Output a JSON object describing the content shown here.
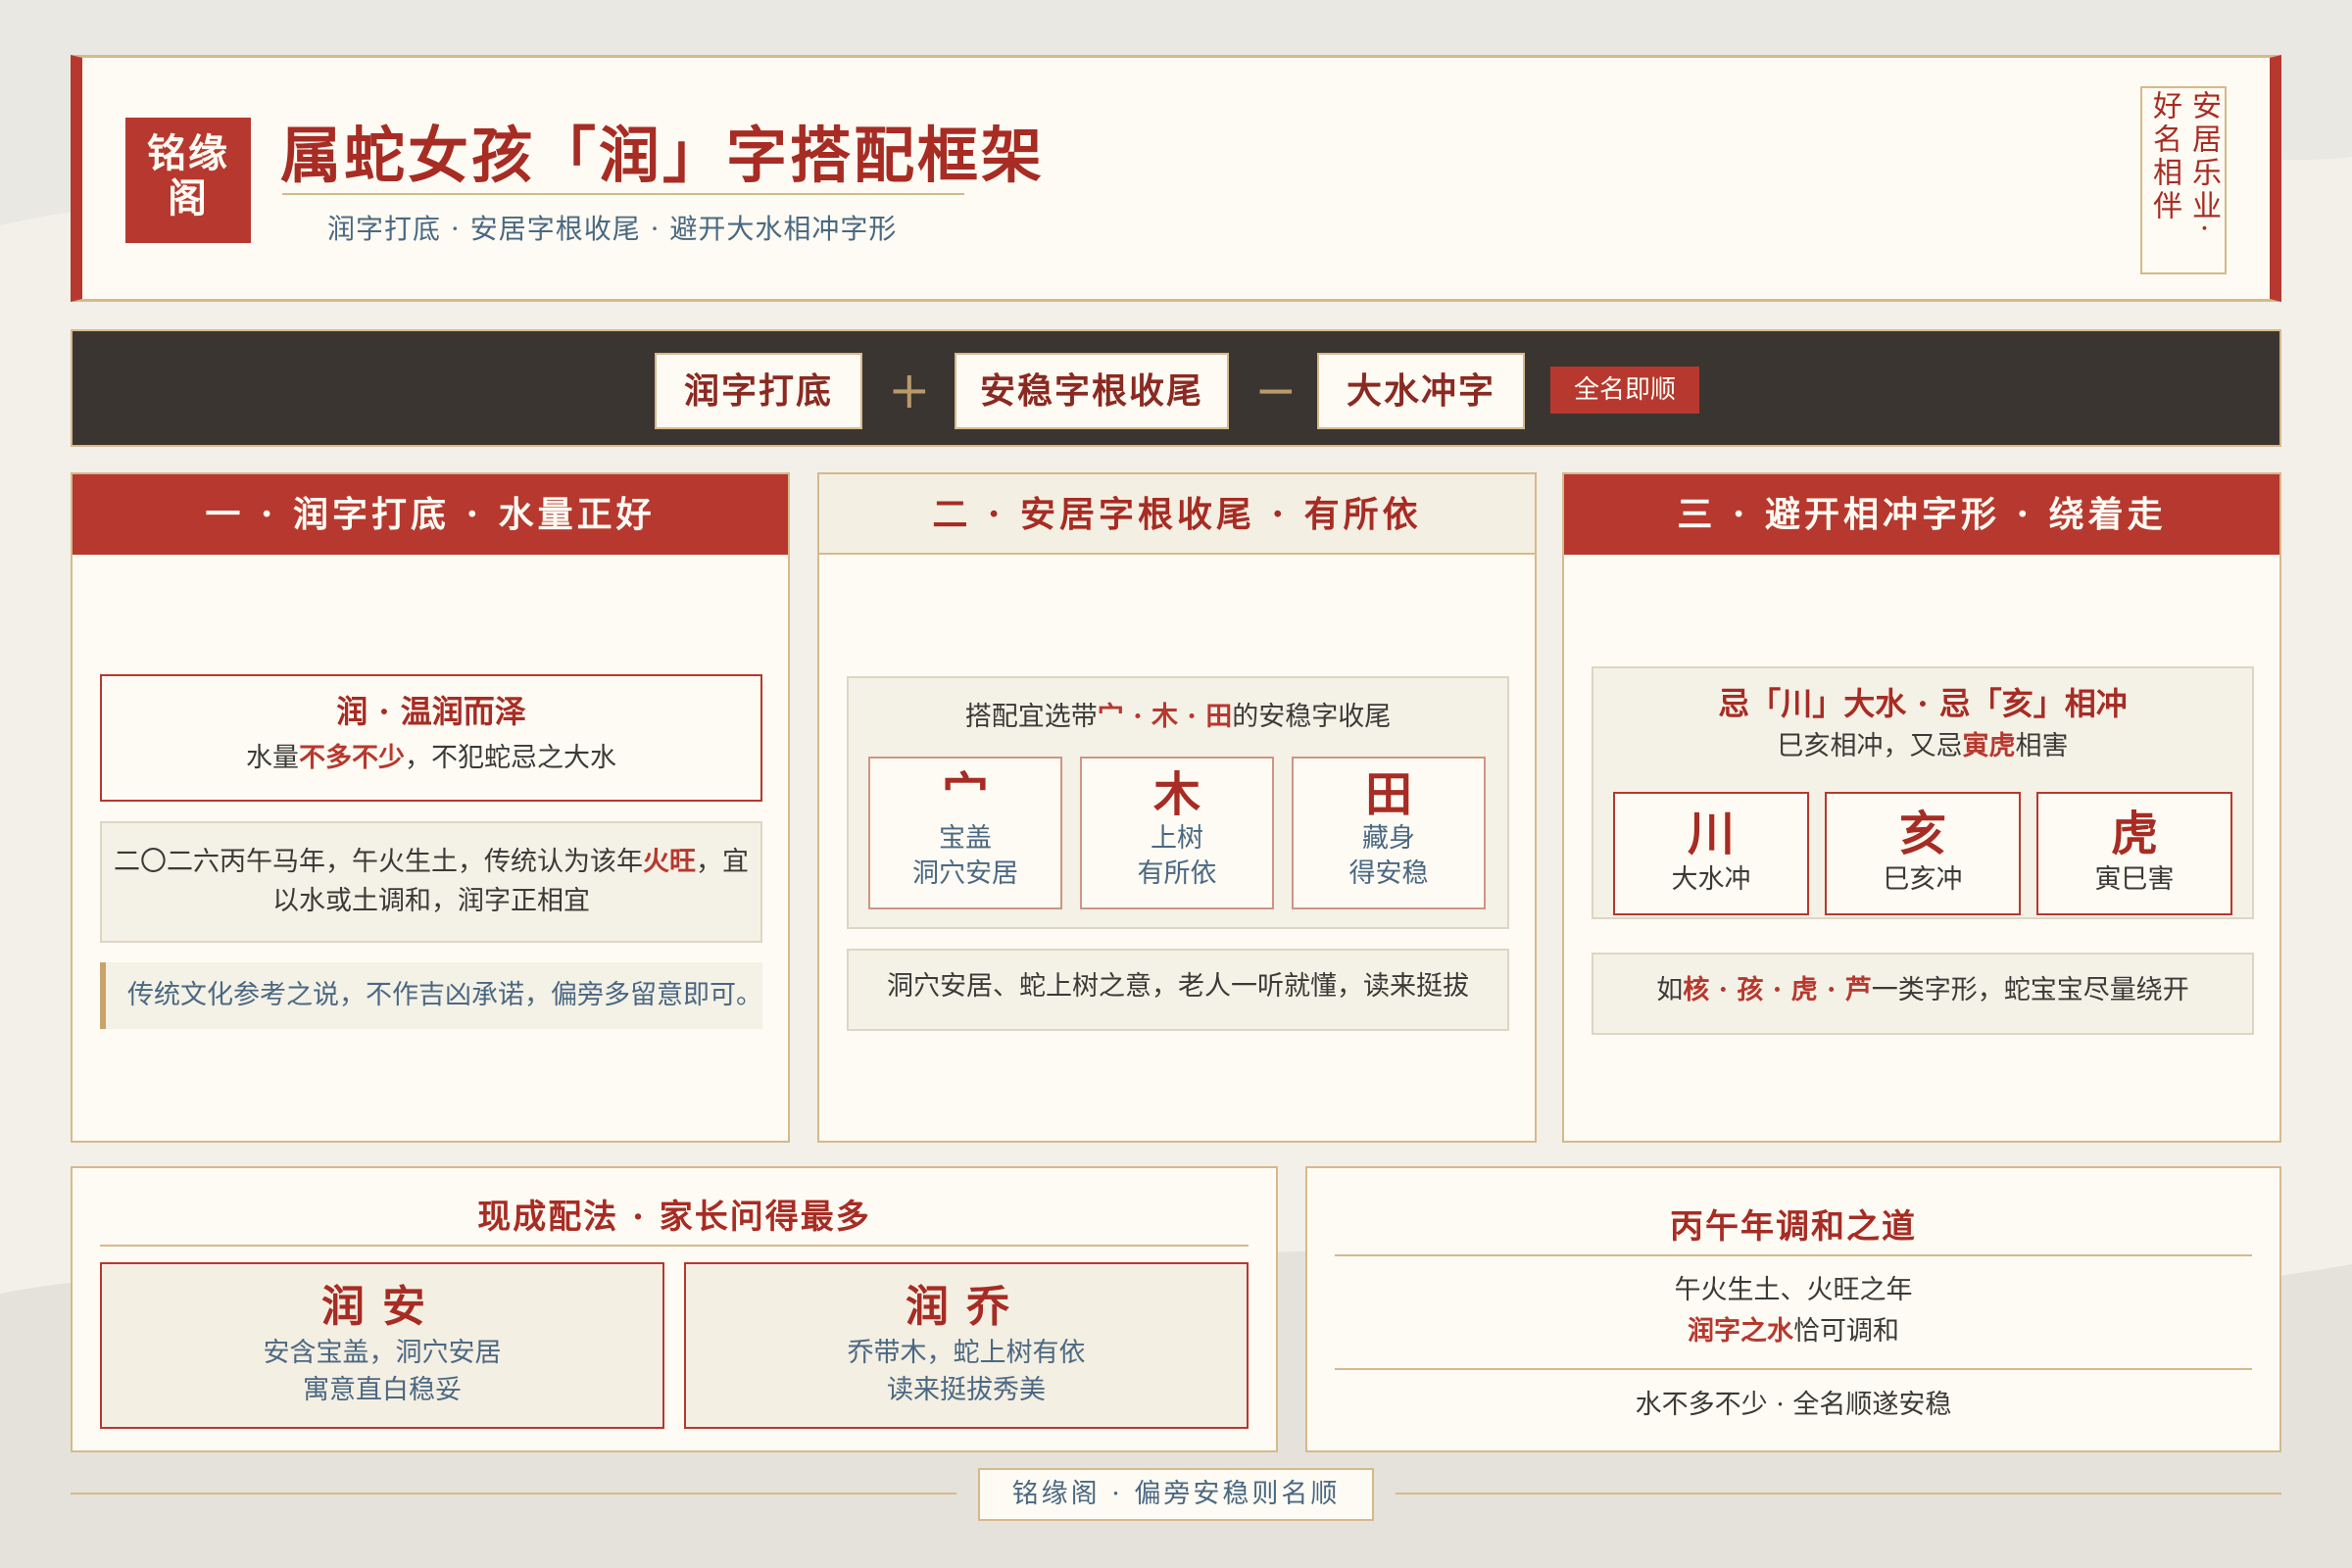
{
  "header": {
    "logo": [
      "铭缘",
      "阁"
    ],
    "title": "属蛇女孩「润」字搭配框架",
    "subtitle": "润字打底 · 安居字根收尾 · 避开大水相冲字形",
    "seal": [
      "安居乐业·",
      "好名相伴"
    ]
  },
  "formula": {
    "item1": "润字打底",
    "op1": "+",
    "item2": "安稳字根收尾",
    "op2": "−",
    "item3": "大水冲字",
    "tag": "全名即顺"
  },
  "col1": {
    "header": "一 · 润字打底 · 水量正好",
    "box_title": "润 · 温润而泽",
    "box_text_pre": "水量",
    "box_text_red": "不多不少",
    "box_text_post": "，不犯蛇忌之大水",
    "para_line1_pre": "二〇二六丙午马年，午火生土，传统认为该年",
    "para_line1_red": "火旺",
    "para_line1_post": "，宜",
    "para_line2": "以水或土调和，润字正相宜",
    "note": "传统文化参考之说，不作吉凶承诺，偏旁多留意即可。"
  },
  "col2": {
    "header": "二 · 安居字根收尾 · 有所依",
    "intro_pre": "搭配宜选带",
    "intro_red": "宀 · 木 · 田",
    "intro_post": "的安稳字收尾",
    "radicals": [
      {
        "char": "宀",
        "line1": "宝盖",
        "line2": "洞穴安居"
      },
      {
        "char": "木",
        "line1": "上树",
        "line2": "有所依"
      },
      {
        "char": "田",
        "line1": "藏身",
        "line2": "得安稳"
      }
    ],
    "note": "洞穴安居、蛇上树之意，老人一听就懂，读来挺拔"
  },
  "col3": {
    "header": "三 · 避开相冲字形 · 绕着走",
    "title": "忌「川」大水 · 忌「亥」相冲",
    "sub_pre": "巳亥相冲，又忌",
    "sub_red": "寅虎",
    "sub_post": "相害",
    "items": [
      {
        "char": "川",
        "label": "大水冲"
      },
      {
        "char": "亥",
        "label": "巳亥冲"
      },
      {
        "char": "虎",
        "label": "寅巳害"
      }
    ],
    "note_pre": "如",
    "note_red": "核 · 孩 · 虎 · 芦",
    "note_post": "一类字形，蛇宝宝尽量绕开"
  },
  "bottom_left": {
    "title": "现成配法 · 家长问得最多",
    "names": [
      {
        "name": "润安",
        "line1": "安含宝盖，洞穴安居",
        "line2": "寓意直白稳妥"
      },
      {
        "name": "润乔",
        "line1": "乔带木，蛇上树有依",
        "line2": "读来挺拔秀美"
      }
    ]
  },
  "bottom_right": {
    "title": "丙午年调和之道",
    "line1": "午火生土、火旺之年",
    "line2_red": "润字之水",
    "line2_post": "恰可调和",
    "line3": "水不多不少 · 全名顺遂安稳"
  },
  "footer": "铭缘阁 · 偏旁安稳则名顺",
  "colors": {
    "accent_red": "#b7382e",
    "gold_border": "#d6b98c",
    "dark_bar": "#3a3530",
    "paper": "#fdfbf3",
    "blue_text": "#4b6882"
  }
}
